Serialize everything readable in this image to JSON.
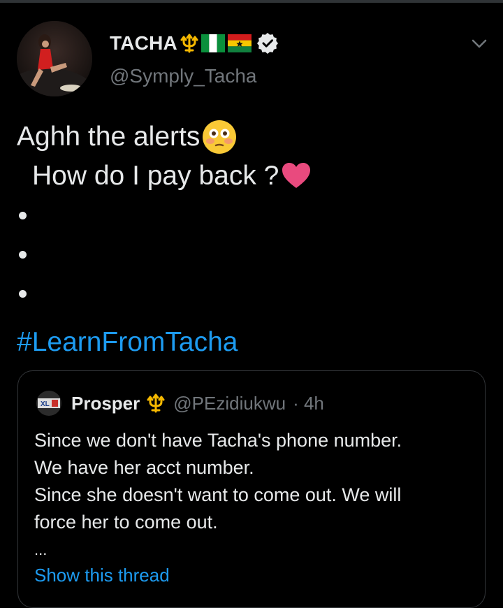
{
  "tweet": {
    "author": {
      "display_name": "TACHA",
      "handle": "@Symply_Tacha",
      "verified": true
    },
    "text_lines": [
      "Aghh the alerts",
      "How do I pay back ?"
    ],
    "hashtag": "#LearnFromTacha"
  },
  "quoted_tweet": {
    "author_name": "Prosper",
    "handle": "@PEzidiukwu",
    "time": "· 4h",
    "avatar_label": "XL",
    "body_lines": [
      "Since we don't have Tacha's phone number.",
      "We have her acct number.",
      "Since she doesn't want to come out. We will",
      "force her to come out."
    ],
    "ellipsis": "...",
    "show_thread": "Show this thread"
  },
  "icons": {
    "trident": "trident-icon",
    "nigeria_flag": "nigeria-flag-icon",
    "ghana_flag": "ghana-flag-icon",
    "verified": "verified-badge-icon",
    "chevron": "chevron-down-icon",
    "flushed_emoji": "flushed-face-emoji",
    "heart_emoji": "heart-emoji"
  },
  "colors": {
    "background": "#000000",
    "text": "#e7e9ea",
    "secondary_text": "#71767b",
    "link": "#1d9bf0",
    "border": "#333639",
    "trident_gold": "#f5b800"
  }
}
